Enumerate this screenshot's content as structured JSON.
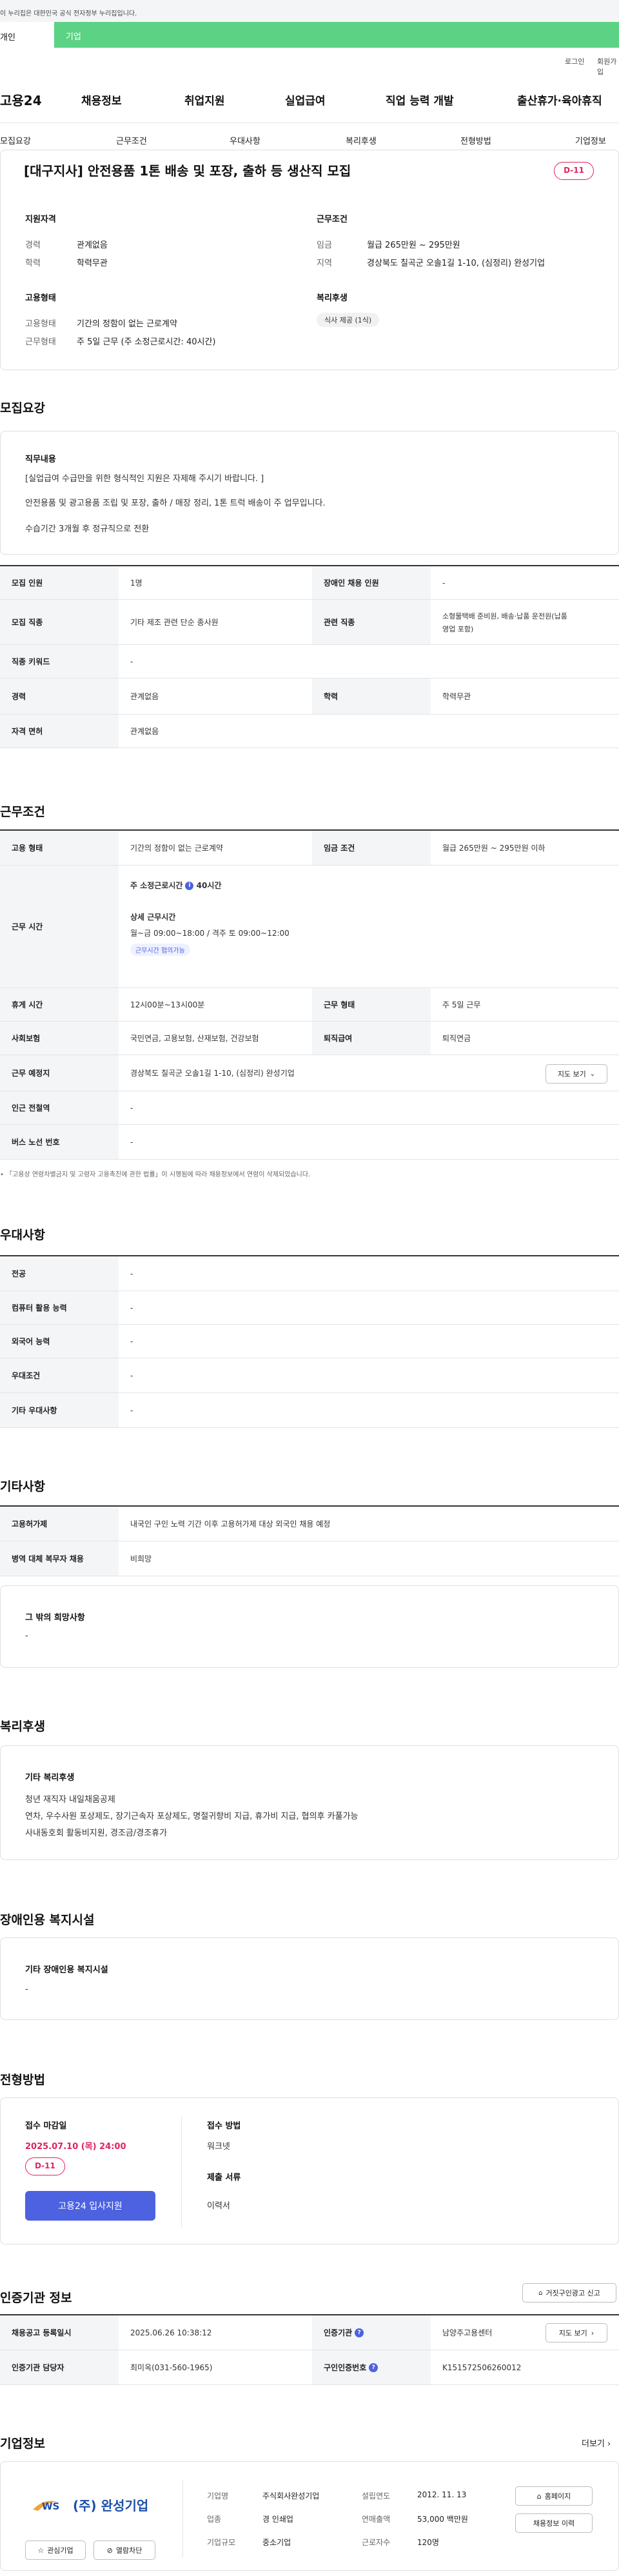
{
  "gov_banner": "이 누리집은 대한민국 공식 전자정부 누리집입니다.",
  "tabs_top": {
    "personal": "개인",
    "company": "기업"
  },
  "util": {
    "login": "로그인",
    "join": "회원가입"
  },
  "gnb": {
    "logo": "고용24",
    "items": [
      "채용정보",
      "취업지원",
      "실업급여",
      "직업 능력 개발",
      "출산휴가·육아휴직"
    ]
  },
  "subtabs": [
    "모집요강",
    "근무조건",
    "우대사항",
    "복리후생",
    "전형방법",
    "기업정보"
  ],
  "job": {
    "title": "[대구지사] 안전용품 1톤 배송 및 포장, 출하 등 생산직 모집",
    "dday": "D-11",
    "qual_h": "지원자격",
    "cond_h": "근무조건",
    "career_k": "경력",
    "career_v": "관계없음",
    "edu_k": "학력",
    "edu_v": "학력무관",
    "wage_k": "임금",
    "wage_v": "월급 265만원 ~ 295만원",
    "area_k": "지역",
    "area_v": "경상북도 칠곡군 오솔1길 1-10, (심정리) 완성기업",
    "emp_h": "고용형태",
    "welfare_h": "복리후생",
    "type_k": "고용형태",
    "type_v": "기간의 정함이 없는 근로계약",
    "work_k": "근무형태",
    "work_v": "주 5일 근무 (주 소정근로시간: 40시간)",
    "chip": "식사 제공 (1식)"
  },
  "recruit": {
    "section": "모집요강",
    "duty_h": "직무내용",
    "duty_lines": [
      "[실업급여 수급만을 위한 형식적인 지원은 자제해 주시기 바랍니다. ]",
      "안전용품 및 광고용품 조립 및 포장, 출하 / 매장 정리, 1톤 트럭 배송이 주 업무입니다.",
      "수습기간 3개월 후 정규직으로 전환"
    ],
    "rows": [
      {
        "k1": "모집 인원",
        "v1": "1명",
        "k2": "장애인 채용 인원",
        "v2": "-"
      },
      {
        "k1": "모집 직종",
        "v1": "기타 제조 관련 단순 종사원",
        "k2": "관련 직종",
        "v2a": "소형물택배 준비원, 배송·납품 운전원(납품",
        "v2b": "영업 포함)"
      },
      {
        "k1": "직종 키워드",
        "v1": "-"
      },
      {
        "k1": "경력",
        "v1": "관계없음",
        "k2": "학력",
        "v2": "학력무관"
      },
      {
        "k1": "자격 면허",
        "v1": "관계없음"
      }
    ]
  },
  "work": {
    "section": "근무조건",
    "type_k": "고용 형태",
    "type_v": "기간의 정함이 없는 근로계약",
    "wage_k": "임금 조건",
    "wage_v": "월급 265만원 ~ 295만원 이하",
    "time_k": "근무 시간",
    "time_main": "주 소정근로시간",
    "time_badge_text": "40시간",
    "detail_h": "상세 근무시간",
    "detail_v": "월~금 09:00~18:00 / 격주 토 09:00~12:00",
    "flex": "근무시간 협의가능",
    "rest_k": "휴게 시간",
    "rest_v": "12시00분~13시00분",
    "form_k": "근무 형태",
    "form_v": "주 5일 근무",
    "ins_k": "사회보험",
    "ins_v": "국민연금, 고용보험, 산재보험, 건강보험",
    "ret_k": "퇴직급여",
    "ret_v": "퇴직연금",
    "place_k": "근무 예정지",
    "place_v": "경상북도 칠곡군 오솔1길 1-10, (심정리) 완성기업",
    "map_btn": "지도 보기",
    "subway_k": "인근 전철역",
    "subway_v": "-",
    "bus_k": "버스 노선 번호",
    "bus_v": "-",
    "note": "「고용상 연령차별금지 및 고령자 고용촉진에 관한 법률」이 시행됨에 따라 채용정보에서 연령이 삭제되었습니다."
  },
  "pref": {
    "section": "우대사항",
    "rows": [
      [
        "전공",
        "-"
      ],
      [
        "컴퓨터 활용 능력",
        "-"
      ],
      [
        "외국어 능력",
        "-"
      ],
      [
        "우대조건",
        "-"
      ],
      [
        "기타 우대사항",
        "-"
      ]
    ]
  },
  "etc": {
    "section": "기타사항",
    "rows": [
      [
        "고용허가제",
        "내국인 구인 노력 기간 이후 고용허가제 대상 외국인 채용 예정"
      ],
      [
        "병역 대체 복무자 채용",
        "비희망"
      ]
    ],
    "other_h": "그 밖의 희망사항",
    "other_v": "-"
  },
  "welfare": {
    "section": "복리후생",
    "h": "기타 복리후생",
    "lines": [
      "청년 재직자 내일채움공제",
      "연차, 우수사원 포상제도, 장기근속자 포상제도, 명절귀향비 지급, 휴가비 지급, 협의후 카풀가능",
      "사내동호회 활동비지원, 경조금/경조휴가"
    ]
  },
  "disab": {
    "section": "장애인용 복지시설",
    "h": "기타 장애인용 복지시설",
    "v": "-"
  },
  "selection": {
    "section": "전형방법",
    "deadline_h": "접수 마감일",
    "deadline_v": "2025.07.10 (목) 24:00",
    "dday": "D-11",
    "apply_btn": "고용24 입사지원",
    "method_h": "접수 방법",
    "method_v": "워크넷",
    "docs_h": "제출 서류",
    "docs_v": "이력서"
  },
  "agency": {
    "section": "인증기관 정보",
    "report_btn": "거짓구인광고 신고",
    "rows": [
      {
        "k1": "채용공고 등록일시",
        "v1": "2025.06.26 10:38:12",
        "k2": "인증기관",
        "v2": "남양주고용센터",
        "btn": "지도 보기"
      },
      {
        "k1": "인증기관 담당자",
        "v1": "최미옥(031-560-1965)",
        "k2": "구인인증번호",
        "v2": "K151572506260012"
      }
    ]
  },
  "company": {
    "section": "기업정보",
    "more": "더보기",
    "logo_text": "(주) 완성기업",
    "fav_btn": "관심기업",
    "block_btn": "열람차단",
    "k_name": "기업명",
    "v_name": "주식회사완성기업",
    "k_year": "설립연도",
    "v_year": "2012. 11. 13",
    "k_ind": "업종",
    "v_ind": "경 인쇄업",
    "k_sales": "연매출액",
    "v_sales": "53,000 백만원",
    "k_size": "기업규모",
    "v_size": "중소기업",
    "k_emp": "근로자수",
    "v_emp": "120명",
    "home_btn": "홈페이지",
    "hist_btn": "채용정보 이력"
  },
  "colors": {
    "accent": "#4c62e1",
    "dday": "#e0245e",
    "green": "#5cd285"
  }
}
